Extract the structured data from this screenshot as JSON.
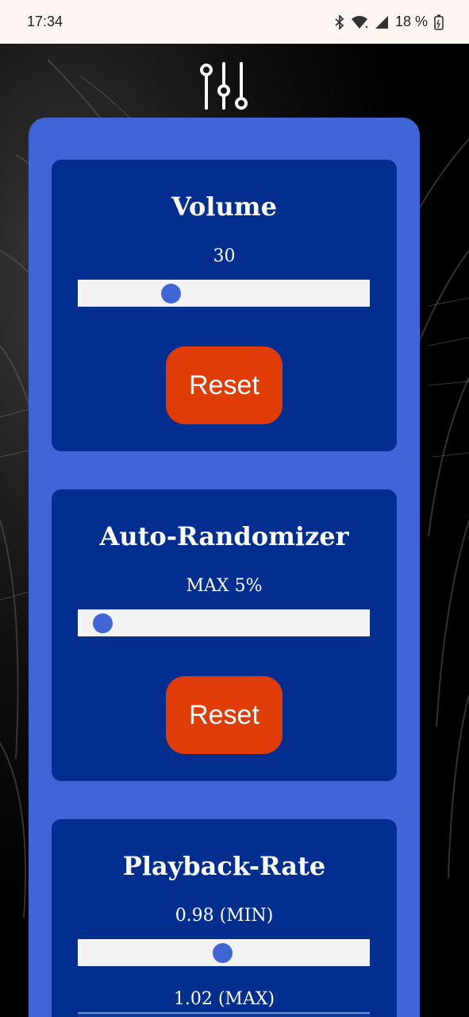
{
  "status_bar": {
    "time": "17:34",
    "battery_text": "18 %",
    "icons": [
      "bluetooth-icon",
      "wifi-icon",
      "signal-icon",
      "battery-icon"
    ]
  },
  "header": {
    "icon": "sliders-icon"
  },
  "volume": {
    "title": "Volume",
    "value": "30",
    "slider_level": 0.3,
    "reset_label": "Reset"
  },
  "randomizer": {
    "title": "Auto-Randomizer",
    "value": "MAX 5%",
    "slider_level": 0.05,
    "reset_label": "Reset"
  },
  "playback": {
    "title": "Playback-Rate",
    "min_value": "0.98 (MIN)",
    "min_slider_level": 0.49,
    "max_value": "1.02 (MAX)"
  },
  "colors": {
    "panel": "#4065d6",
    "card": "#022f8f",
    "reset": "#e03c08",
    "thumb": "#3f66d4"
  }
}
